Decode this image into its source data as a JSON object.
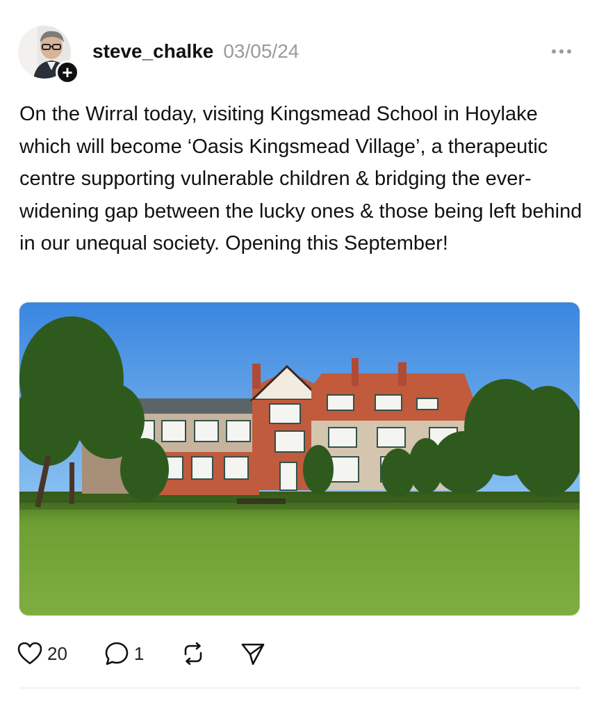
{
  "post": {
    "username": "steve_chalke",
    "date": "03/05/24",
    "follow_symbol": "+",
    "text": "On the Wirral today, visiting Kingsmead School in Hoylake which will become ‘Oasis Kingsmead Village’, a therapeutic centre supporting vulnerable children & bridging the ever-widening gap between the lucky ones & those being left behind in our unequal society. Opening this September!",
    "likes": "20",
    "replies": "1"
  },
  "icons": {
    "more": "more-horizontal-icon",
    "like": "heart-icon",
    "reply": "speech-bubble-icon",
    "repost": "repost-icon",
    "share": "send-icon"
  },
  "colors": {
    "text": "#111111",
    "muted": "#9a9a9a",
    "sky": "#3f8be0",
    "grass": "#6e9f34",
    "brick": "#b8563e"
  }
}
